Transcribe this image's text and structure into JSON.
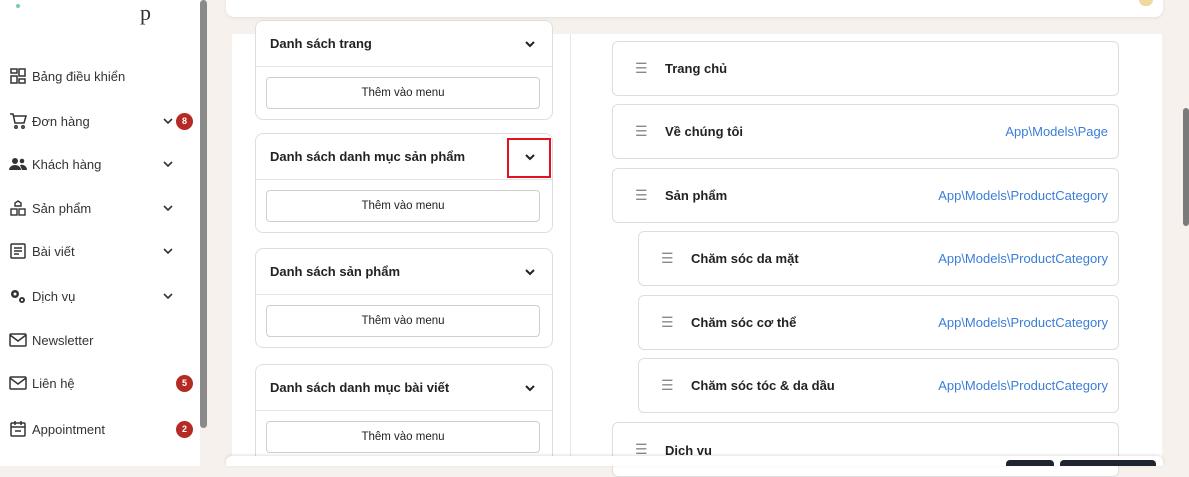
{
  "sidebar": {
    "logo_fragment": "p",
    "items": [
      {
        "label": "Bảng điều khiển",
        "icon": "dashboard-icon"
      },
      {
        "label": "Đơn hàng",
        "icon": "cart-icon",
        "has_chevron": true,
        "badge": "8"
      },
      {
        "label": "Khách hàng",
        "icon": "users-icon",
        "has_chevron": true
      },
      {
        "label": "Sản phẩm",
        "icon": "boxes-icon",
        "has_chevron": true
      },
      {
        "label": "Bài viết",
        "icon": "article-icon",
        "has_chevron": true
      },
      {
        "label": "Dịch vụ",
        "icon": "cogs-icon",
        "has_chevron": true
      },
      {
        "label": "Newsletter",
        "icon": "mail-icon"
      },
      {
        "label": "Liên hệ",
        "icon": "mail-icon",
        "badge": "5"
      },
      {
        "label": "Appointment",
        "icon": "calendar-icon",
        "badge": "2"
      }
    ]
  },
  "sources": [
    {
      "title": "Danh sách trang",
      "button": "Thêm vào menu"
    },
    {
      "title": "Danh sách danh mục sản phẩm",
      "button": "Thêm vào menu"
    },
    {
      "title": "Danh sách sản phẩm",
      "button": "Thêm vào menu"
    },
    {
      "title": "Danh sách danh mục bài viết",
      "button": "Thêm vào menu"
    }
  ],
  "menu_items": [
    {
      "title": "Trang chủ",
      "type": ""
    },
    {
      "title": "Về chúng tôi",
      "type": "App\\Models\\Page"
    },
    {
      "title": "Sản phẩm",
      "type": "App\\Models\\ProductCategory"
    },
    {
      "title": "Chăm sóc da mặt",
      "type": "App\\Models\\ProductCategory"
    },
    {
      "title": "Chăm sóc cơ thể",
      "type": "App\\Models\\ProductCategory"
    },
    {
      "title": "Chăm sóc tóc & da dầu",
      "type": "App\\Models\\ProductCategory"
    },
    {
      "title": "Dịch vụ",
      "type": ""
    }
  ],
  "colors": {
    "badge": "#b52a25",
    "link": "#3b7dd8",
    "highlight": "#e0141e"
  }
}
